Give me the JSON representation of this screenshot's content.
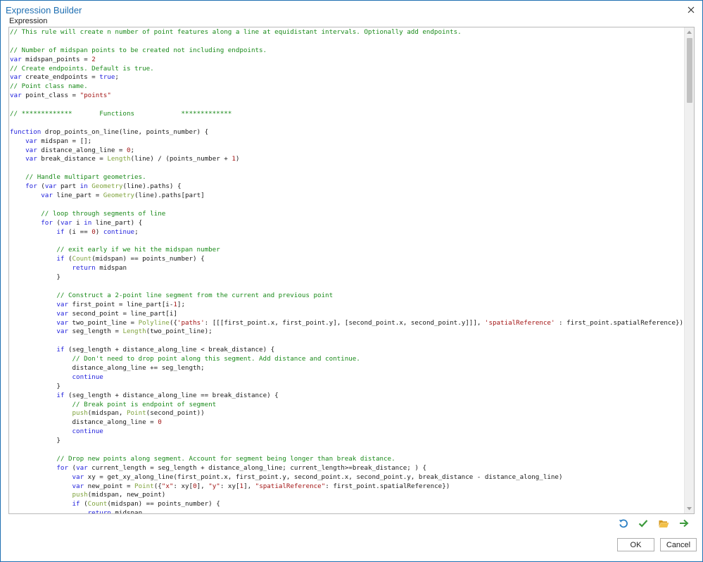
{
  "window": {
    "title": "Expression Builder",
    "close_icon": "close-icon"
  },
  "section": {
    "label": "Expression"
  },
  "colors": {
    "accent": "#1f6fb2",
    "comment": "#1a8a1a",
    "keyword": "#1f1fdc",
    "string": "#a31515",
    "function": "#7fa33c"
  },
  "editor": {
    "lines": [
      [
        [
          "c",
          "// This rule will create n number of point features along a line at equidistant intervals. Optionally add endpoints."
        ]
      ],
      [],
      [
        [
          "c",
          "// Number of midspan points to be created not including endpoints."
        ]
      ],
      [
        [
          "k",
          "var"
        ],
        [
          "p",
          " midspan_points = "
        ],
        [
          "n",
          "2"
        ]
      ],
      [
        [
          "c",
          "// Create endpoints. Default is true."
        ]
      ],
      [
        [
          "k",
          "var"
        ],
        [
          "p",
          " create_endpoints = "
        ],
        [
          "k",
          "true"
        ],
        [
          "p",
          ";"
        ]
      ],
      [
        [
          "c",
          "// Point class name."
        ]
      ],
      [
        [
          "k",
          "var"
        ],
        [
          "p",
          " point_class = "
        ],
        [
          "s",
          "\"points\""
        ]
      ],
      [],
      [
        [
          "c",
          "// *************       Functions            *************"
        ]
      ],
      [],
      [
        [
          "k",
          "function"
        ],
        [
          "p",
          " drop_points_on_line(line, points_number) {"
        ]
      ],
      [
        [
          "p",
          "    "
        ],
        [
          "k",
          "var"
        ],
        [
          "p",
          " midspan = [];"
        ]
      ],
      [
        [
          "p",
          "    "
        ],
        [
          "k",
          "var"
        ],
        [
          "p",
          " distance_along_line = "
        ],
        [
          "n",
          "0"
        ],
        [
          "p",
          ";"
        ]
      ],
      [
        [
          "p",
          "    "
        ],
        [
          "k",
          "var"
        ],
        [
          "p",
          " break_distance = "
        ],
        [
          "f",
          "Length"
        ],
        [
          "p",
          "(line) / (points_number + "
        ],
        [
          "n",
          "1"
        ],
        [
          "p",
          ")"
        ]
      ],
      [],
      [
        [
          "p",
          "    "
        ],
        [
          "c",
          "// Handle multipart geometries."
        ]
      ],
      [
        [
          "p",
          "    "
        ],
        [
          "k",
          "for"
        ],
        [
          "p",
          " ("
        ],
        [
          "k",
          "var"
        ],
        [
          "p",
          " part "
        ],
        [
          "k",
          "in"
        ],
        [
          "p",
          " "
        ],
        [
          "f",
          "Geometry"
        ],
        [
          "p",
          "(line).paths) {"
        ]
      ],
      [
        [
          "p",
          "        "
        ],
        [
          "k",
          "var"
        ],
        [
          "p",
          " line_part = "
        ],
        [
          "f",
          "Geometry"
        ],
        [
          "p",
          "(line).paths[part]"
        ]
      ],
      [],
      [
        [
          "p",
          "        "
        ],
        [
          "c",
          "// loop through segments of line"
        ]
      ],
      [
        [
          "p",
          "        "
        ],
        [
          "k",
          "for"
        ],
        [
          "p",
          " ("
        ],
        [
          "k",
          "var"
        ],
        [
          "p",
          " i "
        ],
        [
          "k",
          "in"
        ],
        [
          "p",
          " line_part) {"
        ]
      ],
      [
        [
          "p",
          "            "
        ],
        [
          "k",
          "if"
        ],
        [
          "p",
          " (i == "
        ],
        [
          "n",
          "0"
        ],
        [
          "p",
          ") "
        ],
        [
          "k",
          "continue"
        ],
        [
          "p",
          ";"
        ]
      ],
      [],
      [
        [
          "p",
          "            "
        ],
        [
          "c",
          "// exit early if we hit the midspan number"
        ]
      ],
      [
        [
          "p",
          "            "
        ],
        [
          "k",
          "if"
        ],
        [
          "p",
          " ("
        ],
        [
          "f",
          "Count"
        ],
        [
          "p",
          "(midspan) == points_number) {"
        ]
      ],
      [
        [
          "p",
          "                "
        ],
        [
          "k",
          "return"
        ],
        [
          "p",
          " midspan"
        ]
      ],
      [
        [
          "p",
          "            }"
        ]
      ],
      [],
      [
        [
          "p",
          "            "
        ],
        [
          "c",
          "// Construct a 2-point line segment from the current and previous point"
        ]
      ],
      [
        [
          "p",
          "            "
        ],
        [
          "k",
          "var"
        ],
        [
          "p",
          " first_point = line_part[i-"
        ],
        [
          "n",
          "1"
        ],
        [
          "p",
          "];"
        ]
      ],
      [
        [
          "p",
          "            "
        ],
        [
          "k",
          "var"
        ],
        [
          "p",
          " second_point = line_part[i]"
        ]
      ],
      [
        [
          "p",
          "            "
        ],
        [
          "k",
          "var"
        ],
        [
          "p",
          " two_point_line = "
        ],
        [
          "f",
          "Polyline"
        ],
        [
          "p",
          "({"
        ],
        [
          "s",
          "'paths'"
        ],
        [
          "p",
          ": [[[first_point.x, first_point.y], [second_point.x, second_point.y]]], "
        ],
        [
          "s",
          "'spatialReference'"
        ],
        [
          "p",
          " : first_point.spatialReference});"
        ]
      ],
      [
        [
          "p",
          "            "
        ],
        [
          "k",
          "var"
        ],
        [
          "p",
          " seg_length = "
        ],
        [
          "f",
          "Length"
        ],
        [
          "p",
          "(two_point_line);"
        ]
      ],
      [],
      [
        [
          "p",
          "            "
        ],
        [
          "k",
          "if"
        ],
        [
          "p",
          " (seg_length + distance_along_line < break_distance) {"
        ]
      ],
      [
        [
          "p",
          "                "
        ],
        [
          "c",
          "// Don't need to drop point along this segment. Add distance and continue."
        ]
      ],
      [
        [
          "p",
          "                distance_along_line += seg_length;"
        ]
      ],
      [
        [
          "p",
          "                "
        ],
        [
          "k",
          "continue"
        ]
      ],
      [
        [
          "p",
          "            }"
        ]
      ],
      [
        [
          "p",
          "            "
        ],
        [
          "k",
          "if"
        ],
        [
          "p",
          " (seg_length + distance_along_line == break_distance) {"
        ]
      ],
      [
        [
          "p",
          "                "
        ],
        [
          "c",
          "// Break point is endpoint of segment"
        ]
      ],
      [
        [
          "p",
          "                "
        ],
        [
          "f",
          "push"
        ],
        [
          "p",
          "(midspan, "
        ],
        [
          "f",
          "Point"
        ],
        [
          "p",
          "(second_point))"
        ]
      ],
      [
        [
          "p",
          "                distance_along_line = "
        ],
        [
          "n",
          "0"
        ]
      ],
      [
        [
          "p",
          "                "
        ],
        [
          "k",
          "continue"
        ]
      ],
      [
        [
          "p",
          "            }"
        ]
      ],
      [],
      [
        [
          "p",
          "            "
        ],
        [
          "c",
          "// Drop new points along segment. Account for segment being longer than break distance."
        ]
      ],
      [
        [
          "p",
          "            "
        ],
        [
          "k",
          "for"
        ],
        [
          "p",
          " ("
        ],
        [
          "k",
          "var"
        ],
        [
          "p",
          " current_length = seg_length + distance_along_line; current_length>=break_distance; ) {"
        ]
      ],
      [
        [
          "p",
          "                "
        ],
        [
          "k",
          "var"
        ],
        [
          "p",
          " xy = get_xy_along_line(first_point.x, first_point.y, second_point.x, second_point.y, break_distance - distance_along_line)"
        ]
      ],
      [
        [
          "p",
          "                "
        ],
        [
          "k",
          "var"
        ],
        [
          "p",
          " new_point = "
        ],
        [
          "f",
          "Point"
        ],
        [
          "p",
          "({"
        ],
        [
          "s",
          "\"x\""
        ],
        [
          "p",
          ": xy["
        ],
        [
          "n",
          "0"
        ],
        [
          "p",
          "], "
        ],
        [
          "s",
          "\"y\""
        ],
        [
          "p",
          ": xy["
        ],
        [
          "n",
          "1"
        ],
        [
          "p",
          "], "
        ],
        [
          "s",
          "\"spatialReference\""
        ],
        [
          "p",
          ": first_point.spatialReference})"
        ]
      ],
      [
        [
          "p",
          "                "
        ],
        [
          "f",
          "push"
        ],
        [
          "p",
          "(midspan, new_point)"
        ]
      ],
      [
        [
          "p",
          "                "
        ],
        [
          "k",
          "if"
        ],
        [
          "p",
          " ("
        ],
        [
          "f",
          "Count"
        ],
        [
          "p",
          "(midspan) == points_number) {"
        ]
      ],
      [
        [
          "p",
          "                    "
        ],
        [
          "k",
          "return"
        ],
        [
          "p",
          " midspan"
        ]
      ]
    ]
  },
  "toolbar": {
    "icons": [
      "undo-icon",
      "check-icon",
      "open-folder-icon",
      "arrow-right-icon"
    ]
  },
  "buttons": {
    "ok_label": "OK",
    "cancel_label": "Cancel"
  }
}
